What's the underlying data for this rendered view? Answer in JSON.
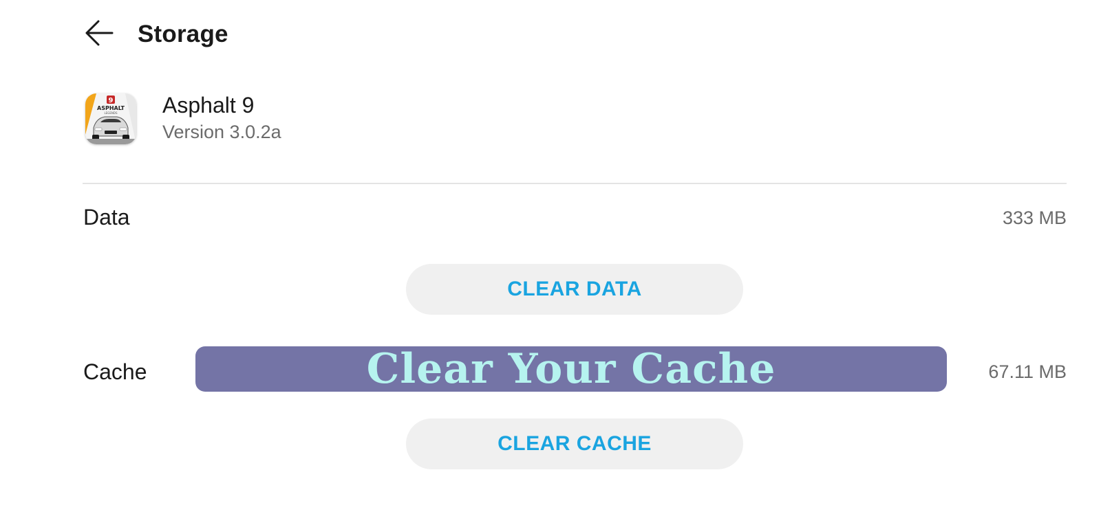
{
  "header": {
    "title": "Storage",
    "back_icon": "arrow-left-icon"
  },
  "app": {
    "name": "Asphalt 9",
    "version": "Version 3.0.2a",
    "icon": "asphalt-9-app-icon",
    "icon_logo_text": "ASPHALT",
    "icon_logo_number": "9",
    "icon_logo_subtext": "LEGENDS"
  },
  "storage": {
    "data": {
      "label": "Data",
      "value": "333 MB",
      "button_label": "CLEAR DATA"
    },
    "cache": {
      "label": "Cache",
      "value": "67.11 MB",
      "button_label": "CLEAR CACHE"
    }
  },
  "overlay": {
    "banner_text": "Clear Your Cache"
  },
  "colors": {
    "accent": "#1aa4e0",
    "button_bg": "#f0f0f0",
    "banner_bg": "#7474a6",
    "banner_text": "#b6f3ef",
    "secondary_text": "#6b6b6b"
  }
}
